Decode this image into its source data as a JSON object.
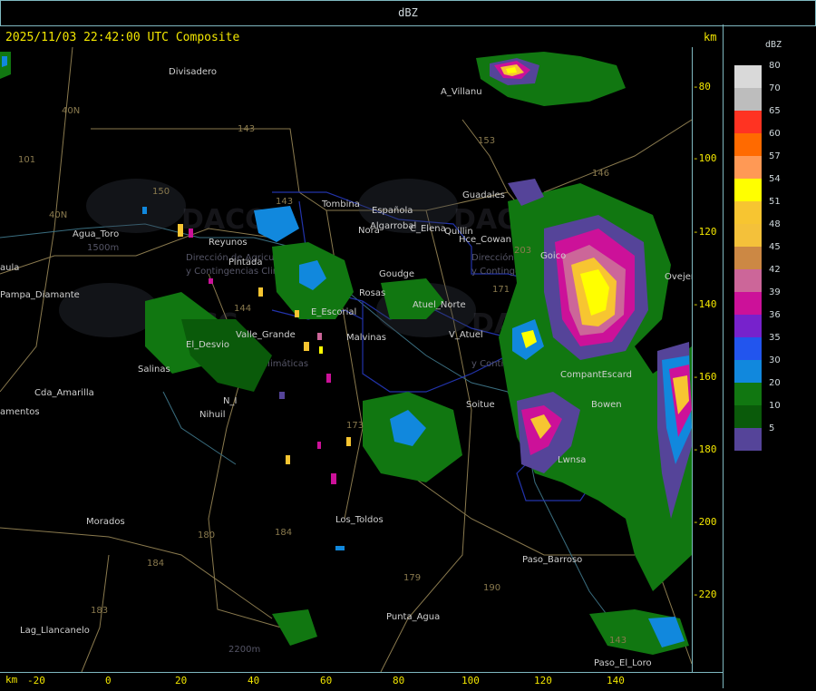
{
  "header": {
    "title": "dBZ"
  },
  "map": {
    "timestamp": "2025/11/03 22:42:00 UTC Composite",
    "unit_top": "km",
    "unit_bottom": "km",
    "y_ticks": [
      "-80",
      "-100",
      "-120",
      "-140",
      "-160",
      "-180",
      "-200",
      "-220"
    ],
    "x_ticks": [
      "-20",
      "0",
      "20",
      "40",
      "60",
      "80",
      "100",
      "120",
      "140"
    ],
    "places": [
      "Divisadero",
      "A_Villanu",
      "Guadales",
      "Agua_Toro",
      "Pampa_Diamante",
      "aula",
      "Reyunos",
      "Pintada",
      "Tombina",
      "Española",
      "C_Elena",
      "Quillin",
      "Hce_Cowan",
      "Algarrobal",
      "Nora",
      "Goudge",
      "Rosas",
      "E_Escorial",
      "Malvinas",
      "Valle_Grande",
      "El_Desvio",
      "Salinas",
      "Cda_Amarilla",
      "N_I",
      "Nihuil",
      "amentos",
      "Soitue",
      "Goico",
      "Ovejer",
      "V_Atuel",
      "Atuel_Norte",
      "Bowen",
      "Morados",
      "Los_Toldos",
      "Paso_Barroso",
      "Punta_Agua",
      "Lag_Llancanelo",
      "Paso_El_Loro",
      "CompantEscard",
      "Lwnsa"
    ],
    "roads": [
      "40N",
      "40N",
      "143",
      "153",
      "146",
      "101",
      "150",
      "143",
      "203",
      "171",
      "144",
      "173",
      "180",
      "184",
      "184",
      "183",
      "179",
      "190",
      "143",
      "1500m",
      "2200m"
    ],
    "watermarks": [
      "DACC",
      "DACC",
      "DACC",
      "DACC"
    ],
    "watermark_text": [
      "Dirección de Agricultura",
      "y Contingencias Climáticas"
    ]
  },
  "legend": {
    "title": "dBZ",
    "levels": [
      {
        "label": "80",
        "color": "#d9d9d9"
      },
      {
        "label": "70",
        "color": "#bdbdbd"
      },
      {
        "label": "65",
        "color": "#ff3322"
      },
      {
        "label": "60",
        "color": "#ff6a00"
      },
      {
        "label": "57",
        "color": "#ff9955"
      },
      {
        "label": "54",
        "color": "#ffff00"
      },
      {
        "label": "51",
        "color": "#f7c531"
      },
      {
        "label": "48",
        "color": "#f4c13a"
      },
      {
        "label": "45",
        "color": "#cc8844"
      },
      {
        "label": "42",
        "color": "#cc6699"
      },
      {
        "label": "39",
        "color": "#cc1199"
      },
      {
        "label": "36",
        "color": "#7722cc"
      },
      {
        "label": "35",
        "color": "#2255ee"
      },
      {
        "label": "30",
        "color": "#1188dd"
      },
      {
        "label": "20",
        "color": "#117711"
      },
      {
        "label": "10",
        "color": "#0a5a0a"
      },
      {
        "label": "5",
        "color": "#554499"
      }
    ]
  },
  "colors": {
    "frame": "#7fb8c0",
    "tick_text": "#f2e600",
    "background": "#000000"
  }
}
